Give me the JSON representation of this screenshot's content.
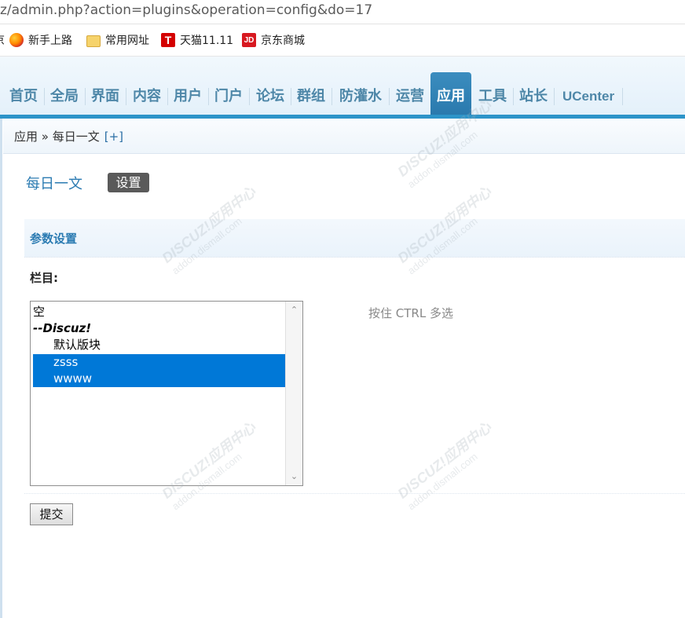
{
  "browser": {
    "address_url": "z/admin.php?action=plugins&operation=config&do=17",
    "bookmarks": [
      {
        "label": "新手上路",
        "icon": "firefox-icon"
      },
      {
        "label": "常用网址",
        "icon": "folder-icon"
      },
      {
        "label": "天猫11.11",
        "icon": "tmall-icon",
        "badge": "T"
      },
      {
        "label": "京东商城",
        "icon": "jd-icon",
        "badge": "JD"
      }
    ],
    "edge_glyph": "京"
  },
  "nav": {
    "items": [
      "首页",
      "全局",
      "界面",
      "内容",
      "用户",
      "门户",
      "论坛",
      "群组",
      "防灌水",
      "运营",
      "应用",
      "工具",
      "站长",
      "UCenter"
    ],
    "active": "应用",
    "accent": "#2d94c9"
  },
  "breadcrumb": {
    "text": "应用 » 每日一文",
    "plus": "[+]"
  },
  "plugin": {
    "title": "每日一文",
    "settings_button": "设置"
  },
  "section": {
    "title": "参数设置"
  },
  "field": {
    "label": "栏目:",
    "hint": "按住 CTRL 多选",
    "options": [
      {
        "text": "空",
        "selected": false
      },
      {
        "text": "--Discuz!",
        "selected": false
      },
      {
        "text": "默认版块",
        "selected": false
      },
      {
        "text": "zsss",
        "selected": true
      },
      {
        "text": "wwww",
        "selected": true
      }
    ]
  },
  "submit_label": "提交",
  "watermark": {
    "brand": "DISCUZ!应用中心",
    "site": "addon.dismall.com"
  },
  "colors": {
    "link": "#2b7bb2",
    "selection": "#0078d7",
    "nav_text": "#4e87a8"
  }
}
